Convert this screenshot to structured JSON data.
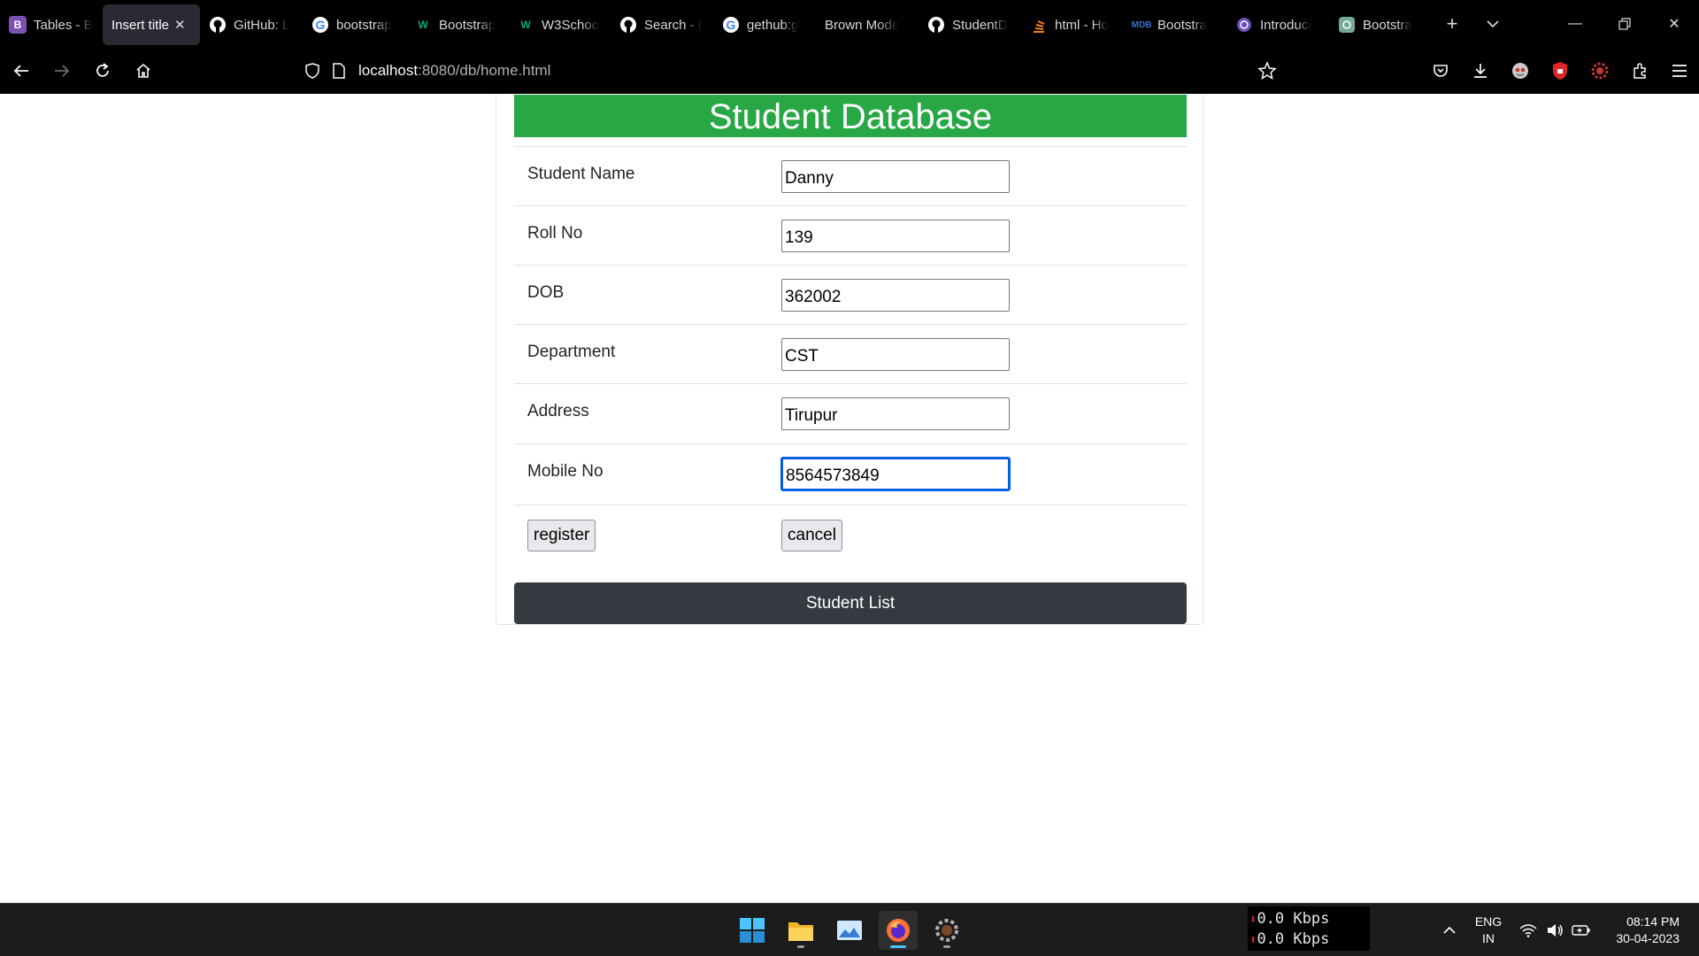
{
  "browser": {
    "tabs": [
      {
        "label": "Tables - B",
        "icon": "bootstrap-icon",
        "active": false
      },
      {
        "label": "Insert title",
        "icon": "",
        "active": true
      },
      {
        "label": "GitHub: L",
        "icon": "github-icon",
        "active": false
      },
      {
        "label": "bootstrap",
        "icon": "google-icon",
        "active": false
      },
      {
        "label": "Bootstrap",
        "icon": "w-icon",
        "active": false
      },
      {
        "label": "W3Schoo",
        "icon": "w-icon",
        "active": false
      },
      {
        "label": "Search - (",
        "icon": "github-icon",
        "active": false
      },
      {
        "label": "gethub:g",
        "icon": "google-icon",
        "active": false
      },
      {
        "label": "Brown Mode",
        "icon": "",
        "active": false
      },
      {
        "label": "StudentD",
        "icon": "github-icon",
        "active": false
      },
      {
        "label": "html - Ho",
        "icon": "stack-icon",
        "active": false
      },
      {
        "label": "Bootstra",
        "icon": "mdb-icon",
        "active": false
      },
      {
        "label": "Introduci",
        "icon": "openai-icon",
        "active": false
      },
      {
        "label": "Bootstra",
        "icon": "openai-icon",
        "active": false
      }
    ],
    "url_host": "localhost",
    "url_path": ":8080/db/home.html"
  },
  "page": {
    "title": "Student Database",
    "fields": [
      {
        "label": "Student Name",
        "value": "Danny"
      },
      {
        "label": "Roll No",
        "value": "139"
      },
      {
        "label": "DOB",
        "value": "362002"
      },
      {
        "label": "Department",
        "value": "CST"
      },
      {
        "label": "Address",
        "value": "Tirupur"
      },
      {
        "label": "Mobile No",
        "value": "8564573849"
      }
    ],
    "register_label": "register",
    "cancel_label": "cancel",
    "student_list_label": "Student List"
  },
  "taskbar": {
    "net_down": "0.0 Kbps",
    "net_up": "0.0 Kbps",
    "lang_1": "ENG",
    "lang_2": "IN",
    "time": "08:14 PM",
    "date": "30-04-2023"
  },
  "colors": {
    "title_bg": "#28a745",
    "list_button_bg": "#343a40",
    "focus_ring": "#0060df"
  }
}
